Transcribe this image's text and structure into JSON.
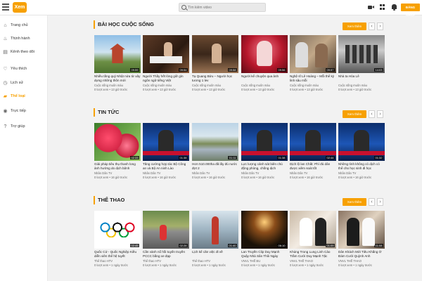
{
  "header": {
    "logo_text": "Xem",
    "search_placeholder": "Tìm kiếm video",
    "login_label": "ĐĂNG NHẬP",
    "accent_color": "#f7a000"
  },
  "sidebar": {
    "items": [
      {
        "label": "Trang chủ",
        "icon": "home-icon"
      },
      {
        "label": "Thịnh hành",
        "icon": "fire-icon"
      },
      {
        "label": "Kênh theo dõi",
        "icon": "subscriptions-icon"
      },
      {
        "label": "Yêu thích",
        "icon": "heart-icon"
      },
      {
        "label": "Lịch sử",
        "icon": "history-icon"
      },
      {
        "label": "Thể loại",
        "icon": "folder-icon",
        "active": true
      },
      {
        "label": "Trực tiếp",
        "icon": "live-icon"
      },
      {
        "label": "Trợ giúp",
        "icon": "help-icon"
      }
    ]
  },
  "sections": [
    {
      "title": "BÀI HỌC CUỘC SỐNG",
      "see_all": "Xem thêm",
      "videos": [
        {
          "title": "Nhiều tầng quý Nhật nửa từ xây dựng những thôn mới",
          "channel": "Cuộc sống muôn màu",
          "meta": "0 lượt xem • 13 giờ trước",
          "duration": "09:59"
        },
        {
          "title": "Người Thầy hết lòng giữ gìn ngôn ngữ tiếng Việt",
          "channel": "Cuộc sống muôn màu",
          "meta": "0 lượt xem • 13 giờ trước",
          "duration": "09:54"
        },
        {
          "title": "Tạ Quang Bửu – Người học tương 1 lev",
          "channel": "Cuộc sống muôn màu",
          "meta": "0 lượt xem • 13 giờ trước",
          "duration": "09:58"
        },
        {
          "title": "Người kể chuyện qua ảnh",
          "channel": "Cuộc sống muôn màu",
          "meta": "0 lượt xem • 13 giờ trước",
          "duration": "09:56"
        },
        {
          "title": "Nghệ sĩ Lê Hoàng – Mỗi thể kỷ linh sâu mỗi",
          "channel": "Cuộc sống muôn màu",
          "meta": "0 lượt xem • 13 giờ trước",
          "duration": "09:57"
        },
        {
          "title": "Nhà ta Hòa Lê",
          "channel": "Cuộc sống muôn màu",
          "meta": "0 lượt xem • 13 giờ trước",
          "duration": "14:03"
        }
      ]
    },
    {
      "title": "TIN TỨC",
      "see_all": "Xem thêm",
      "videos": [
        {
          "title": "Giải pháp tiêu thụ thanh long ảnh hưởng do dịch bệnh",
          "channel": "Nhân Dân TV",
          "meta": "0 lượt xem • 16 giờ trước",
          "duration": "02:33"
        },
        {
          "title": "Tăng cường hợp tác Bộ Công an và Bộ An ninh Lào",
          "channel": "Nhân Dân TV",
          "meta": "0 lượt xem • 16 giờ trước",
          "duration": "01:38"
        },
        {
          "title": "Hơn 510.000ha đã lấy đủ nước đợt 2",
          "channel": "Nhân Dân TV",
          "meta": "0 lượt xem • 16 giờ trước",
          "duration": "01:11"
        },
        {
          "title": "Lực lượng cảnh sát biên chủ động phòng, chống dịch",
          "channel": "Nhân Dân TV",
          "meta": "0 lượt xem • 16 giờ trước",
          "duration": "01:38"
        },
        {
          "title": "Dịch lộ lan Chất: Phí đủ dân được xiêm soát tốt",
          "channel": "Nhân Dân TV",
          "meta": "0 lượt xem • 16 giờ trước",
          "duration": "02:44"
        },
        {
          "title": "Những tình không có dịch có thể cho học sinh đi học",
          "channel": "Nhân Dân TV",
          "meta": "0 lượt xem • 16 giờ trước",
          "duration": "01:32"
        }
      ]
    },
    {
      "title": "THỂ THAO",
      "see_all": "Xem thêm",
      "videos": [
        {
          "title": "Quốc Cử - Quốc Nghiệp Kiều diễn viên thể hệ tuyết",
          "channel": "Thể thao HTV",
          "meta": "0 lượt xem • 1 ngày trước",
          "duration": "02:45"
        },
        {
          "title": "Cần vành nổ hồi tuyển truyền PCCC bằng xe đạp",
          "channel": "Thể thao HTV",
          "meta": "0 lượt xem • 1 ngày trước",
          "duration": "02:28"
        },
        {
          "title": "Lịch kể căn việc đi về",
          "channel": "Thể thao HTV",
          "meta": "0 lượt xem • 1 ngày trước",
          "duration": "01:40"
        },
        {
          "title": "Lan Truyền Clip Duy Mạnh Quậy Nhà Sân Thôi Ngày",
          "channel": "VNVL THỂ BU",
          "meta": "0 lượt xem • 1 ngày trước",
          "duration": "06:10"
        },
        {
          "title": "Khủng Trong Lung Linh Cảo Trầm Cưới Duy Mạnh Tặc",
          "channel": "VNVL THỂ THAO",
          "meta": "0 lượt xem • 1 ngày trước",
          "duration": "01:09"
        },
        {
          "title": "Dân Khách Mới Tiêu Khẳng Ở Đám Cưới Quỳnh Anh",
          "channel": "VNVL THỂ THAO",
          "meta": "0 lượt xem • 1 ngày trước",
          "duration": "01:08"
        }
      ]
    }
  ]
}
